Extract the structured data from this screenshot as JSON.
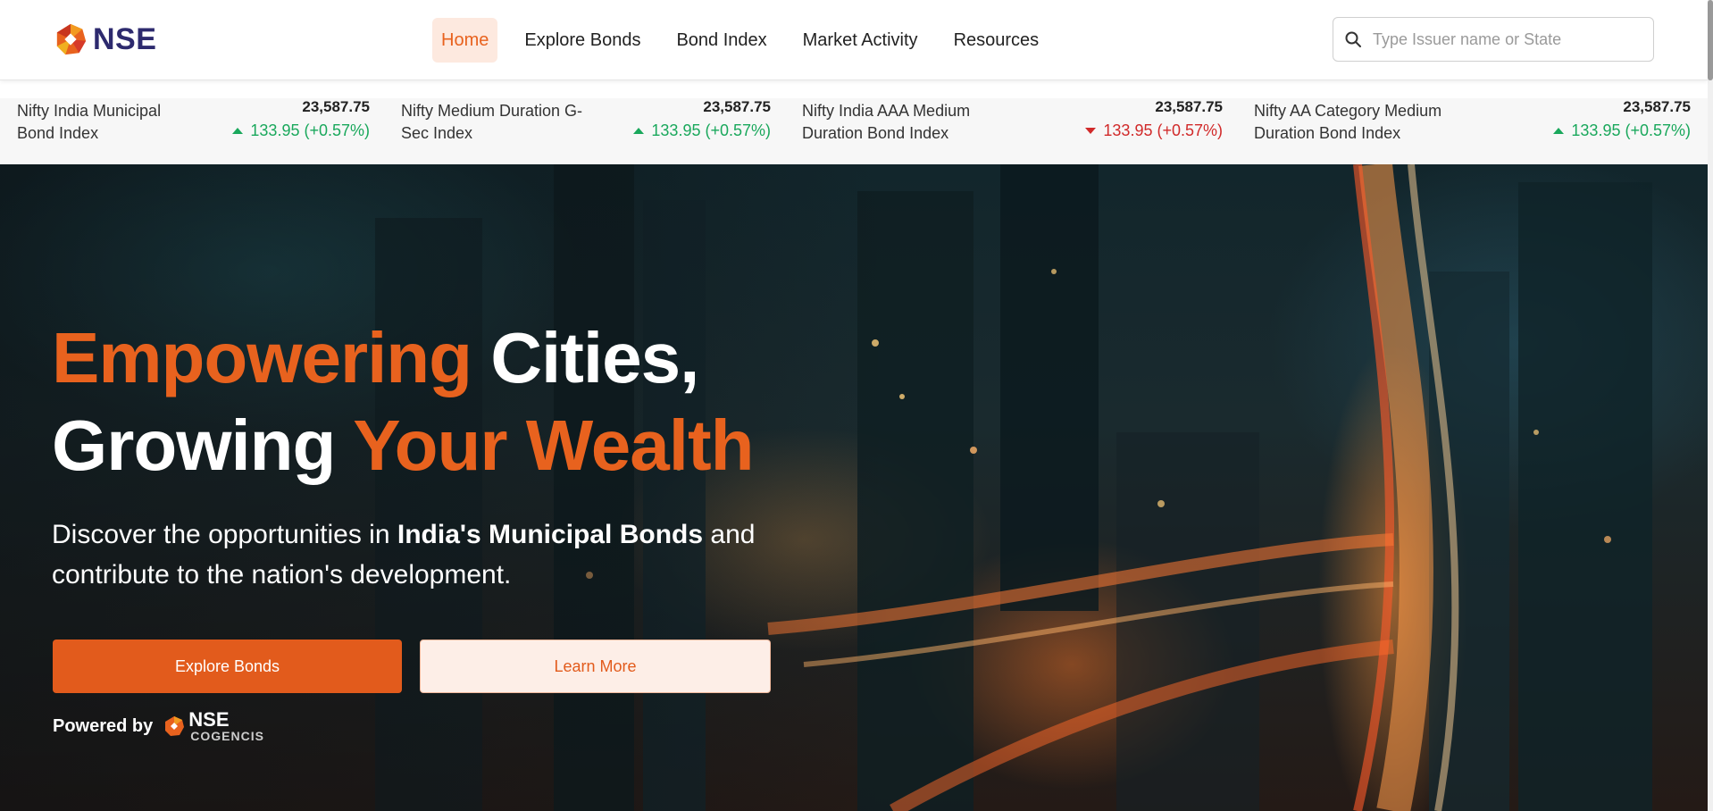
{
  "brand": {
    "name": "NSE",
    "logo_icon": "nse-logo-icon"
  },
  "nav": {
    "items": [
      {
        "label": "Home",
        "active": true
      },
      {
        "label": "Explore Bonds",
        "active": false
      },
      {
        "label": "Bond Index",
        "active": false
      },
      {
        "label": "Market Activity",
        "active": false
      },
      {
        "label": "Resources",
        "active": false
      }
    ]
  },
  "search": {
    "placeholder": "Type Issuer name or State",
    "value": "",
    "icon": "search-icon"
  },
  "ticker": [
    {
      "name_line1": "Nifty India Municipal",
      "name_line2": "Bond Index",
      "value": "23,587.75",
      "change": "133.95 (+0.57%)",
      "direction": "up"
    },
    {
      "name_line1": "Nifty Medium Duration G-",
      "name_line2": "Sec Index",
      "value": "23,587.75",
      "change": "133.95 (+0.57%)",
      "direction": "up"
    },
    {
      "name_line1": "Nifty India AAA Medium",
      "name_line2": "Duration Bond Index",
      "value": "23,587.75",
      "change": "133.95 (+0.57%)",
      "direction": "down"
    },
    {
      "name_line1": "Nifty AA Category Medium",
      "name_line2": "Duration Bond Index",
      "value": "23,587.75",
      "change": "133.95 (+0.57%)",
      "direction": "up"
    }
  ],
  "hero": {
    "headline_1a": "Empowering",
    "headline_1b": "Cities,",
    "headline_2a": "Growing",
    "headline_2b": "Your Wealth",
    "sub_1": "Discover the opportunities in ",
    "sub_bold": "India's Municipal Bonds",
    "sub_2": " and contribute to the nation's development.",
    "primary_button": "Explore Bonds",
    "secondary_button": "Learn More",
    "powered_by": "Powered by",
    "partner_name": "NSE",
    "partner_sub": "COGENCIS"
  },
  "colors": {
    "accent": "#e8621e",
    "brand_navy": "#2d2a6e",
    "up": "#1aa85c",
    "down": "#d12a2a"
  }
}
